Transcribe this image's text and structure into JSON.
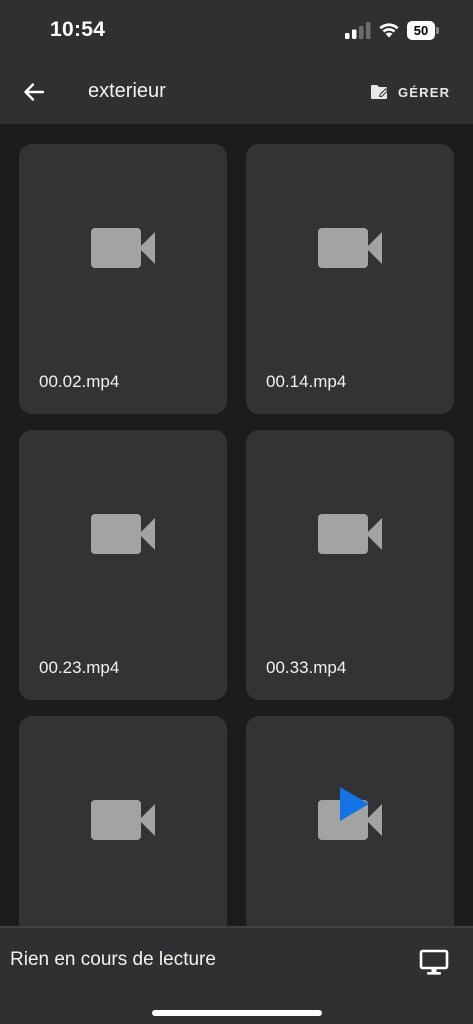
{
  "status_bar": {
    "time": "10:54",
    "battery_level": "50"
  },
  "app_bar": {
    "title": "exterieur",
    "manage_label": "GÉRER"
  },
  "files": [
    {
      "name": "00.02.mp4",
      "icon": "video-camera-icon"
    },
    {
      "name": "00.14.mp4",
      "icon": "video-camera-icon"
    },
    {
      "name": "00.23.mp4",
      "icon": "video-camera-icon"
    },
    {
      "name": "00.33.mp4",
      "icon": "video-camera-icon"
    },
    {
      "name": "",
      "icon": "video-camera-icon"
    },
    {
      "name": "",
      "icon": "video-camera-icon",
      "playing_indicator": "play-icon"
    }
  ],
  "now_playing": {
    "text": "Rien en cours de lecture",
    "cast_icon": "monitor-icon"
  },
  "colors": {
    "background": "#1c1c1e",
    "bar": "#303032",
    "tile": "#333335",
    "icon": "#a3a3a3",
    "play_accent": "#1473e6"
  }
}
